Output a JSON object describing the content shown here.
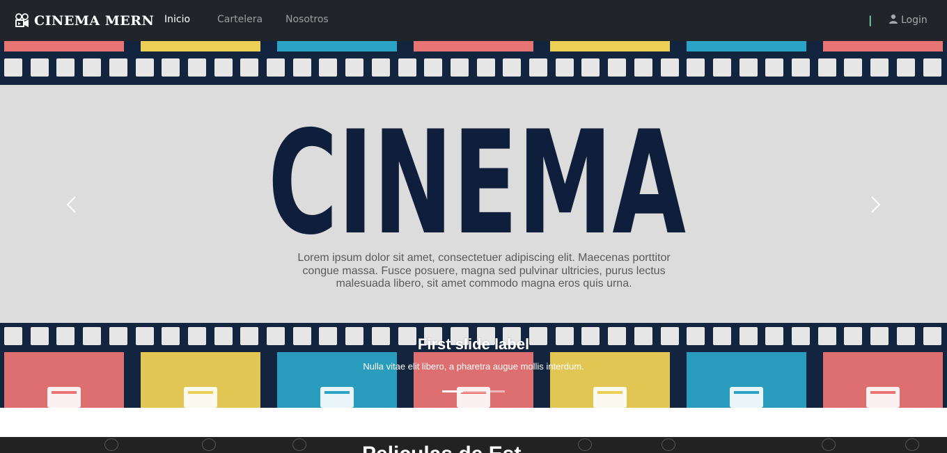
{
  "navbar": {
    "brand": "CINEMA MERN",
    "brand_icon": "film-camera-icon",
    "links": [
      {
        "label": "Inicio",
        "active": true
      },
      {
        "label": "Cartelera",
        "active": false
      },
      {
        "label": "Nosotros",
        "active": false
      }
    ],
    "separator": "|",
    "login_label": "Login",
    "login_icon": "user-icon"
  },
  "carousel": {
    "banner_title": "CINEMA",
    "banner_text_lines": [
      "Lorem ipsum dolor sit amet, consectetuer adipiscing elit. Maecenas porttitor",
      "congue massa. Fusce posuere, magna sed pulvinar ultricies, purus lectus",
      "malesuada libero, sit amet commodo magna eros quis urna."
    ],
    "caption_title": "First slide label",
    "caption_text": "Nulla vitae elit libero, a pharetra augue mollis interdum.",
    "prev_icon": "chevron-left-icon",
    "next_icon": "chevron-right-icon",
    "slide_count": 3,
    "active_slide": 1,
    "film_colors": [
      "#e87474",
      "#ecd055",
      "#2ba3c4",
      "#e87474",
      "#ecd055",
      "#2ba3c4",
      "#e87474"
    ],
    "tile_icons": [
      "clapperboard-icon",
      "organ-pipes-icon",
      "trumpet-icon",
      "gong-icon",
      "drum-icon",
      "palette-icon",
      "music-notes-icon"
    ]
  },
  "bottom": {
    "heading": "Peliculas de Est"
  },
  "colors": {
    "navbar_bg": "#212529",
    "film_strip": "#13243f",
    "banner_bg": "#dcdcdc",
    "title_color": "#0f1e3b"
  }
}
